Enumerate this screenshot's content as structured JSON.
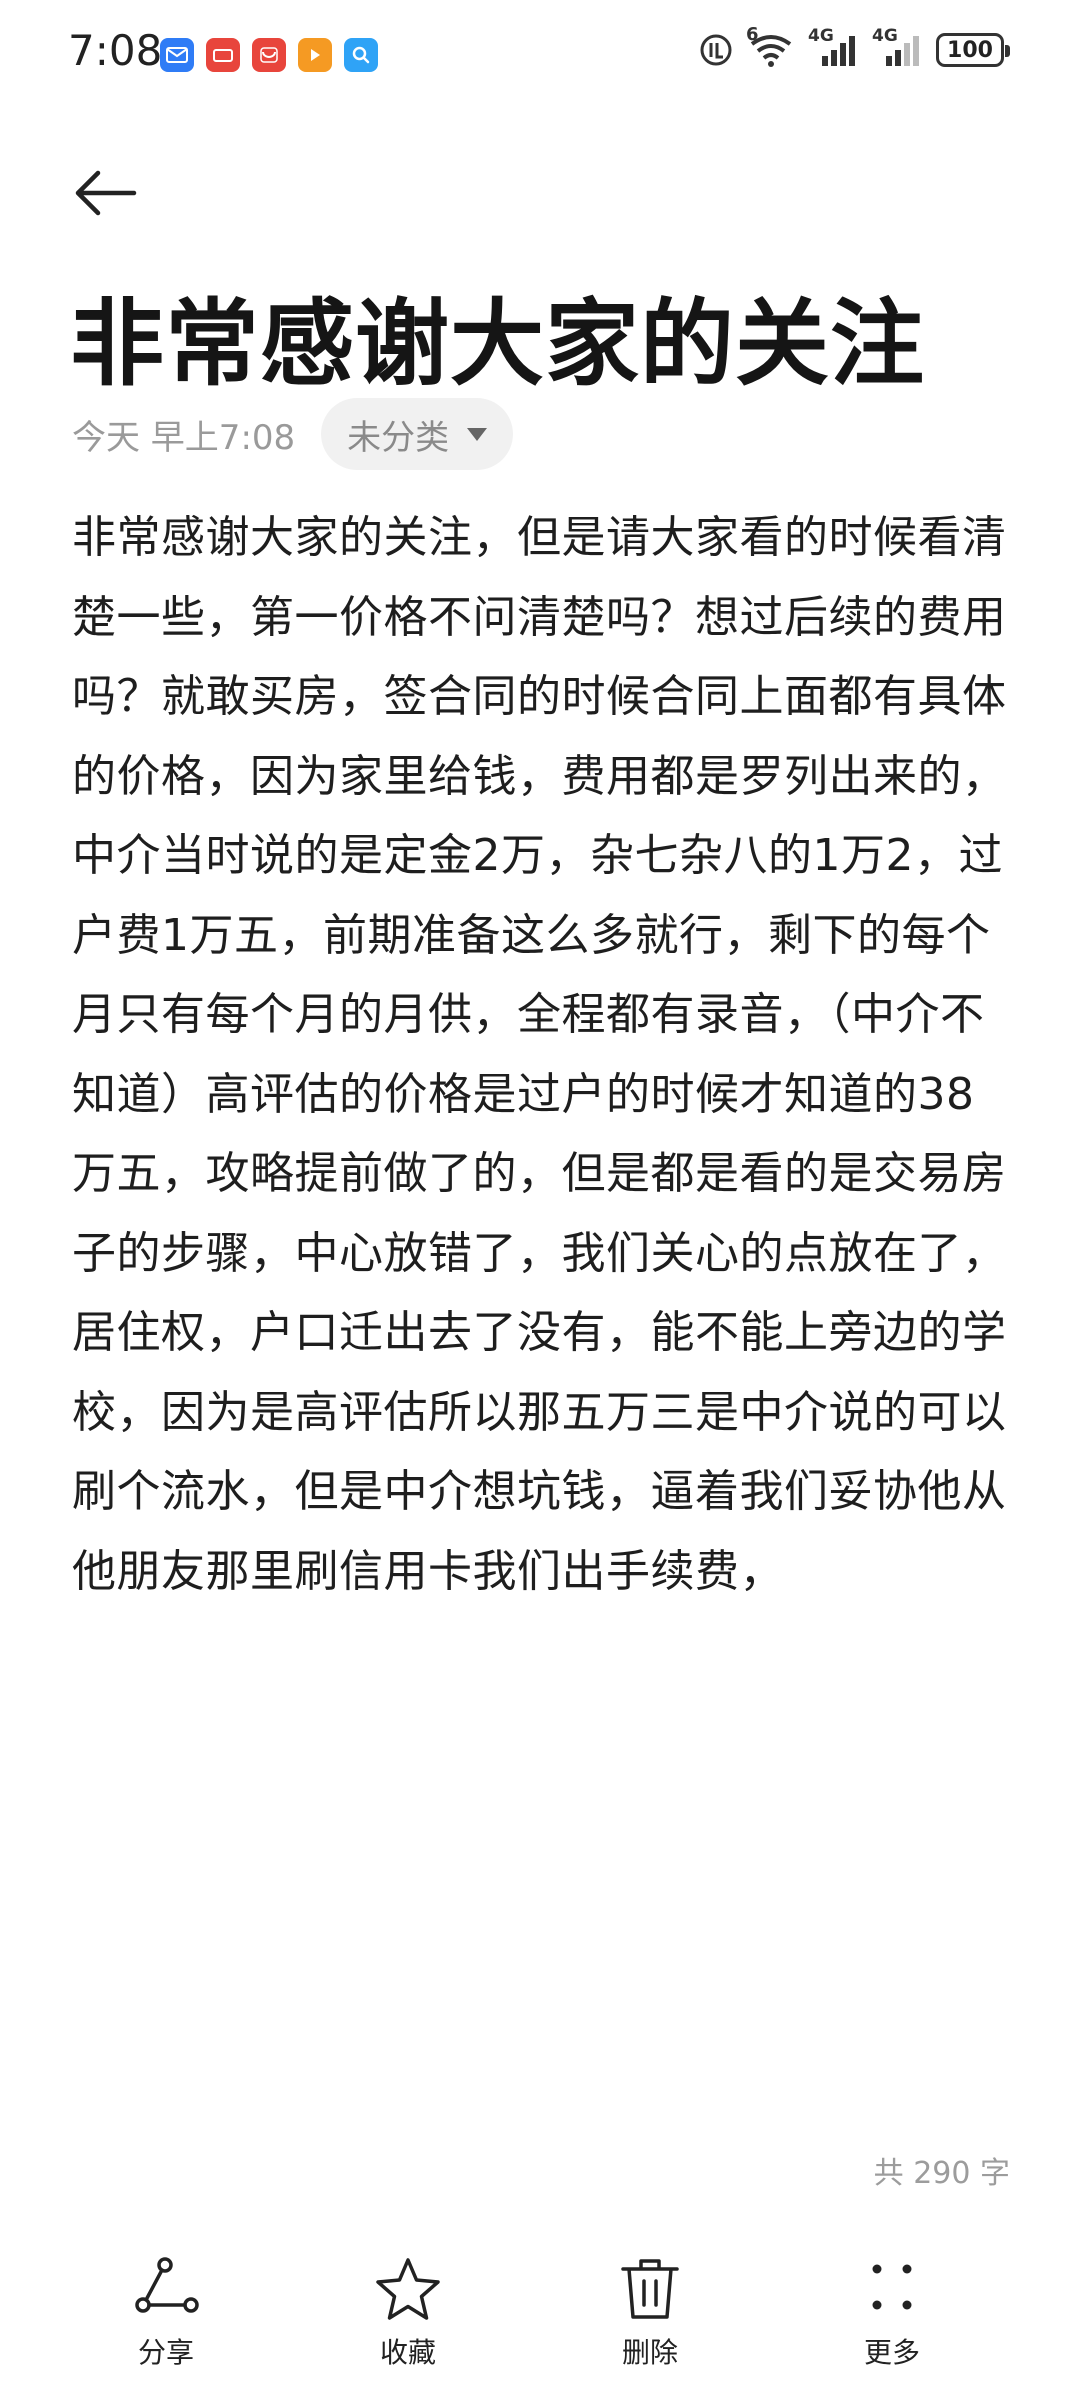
{
  "status_bar": {
    "time": "7:08",
    "network_label_1": "4G",
    "network_label_2": "4G",
    "wifi_superscript": "6",
    "battery": "100",
    "notification_icons": [
      "mail-icon",
      "shop-icon",
      "huawei-store-icon",
      "video-icon",
      "search-app-icon"
    ]
  },
  "note": {
    "title": "非常感谢大家的关注",
    "date": "今天 早上7:08",
    "category": "未分类",
    "content": "非常感谢大家的关注，但是请大家看的时候看清楚一些，第一价格不问清楚吗？想过后续的费用吗？就敢买房，签合同的时候合同上面都有具体的价格，因为家里给钱，费用都是罗列出来的，中介当时说的是定金2万，杂七杂八的1万2，过户费1万五，前期准备这么多就行，剩下的每个月只有每个月的月供，全程都有录音，（中介不知道）高评估的价格是过户的时候才知道的38万五，攻略提前做了的，但是都是看的是交易房子的步骤，中心放错了，我们关心的点放在了，居住权，户口迁出去了没有，能不能上旁边的学校，因为是高评估所以那五万三是中介说的可以刷个流水，但是中介想坑钱，逼着我们妥协他从他朋友那里刷信用卡我们出手续费，",
    "word_count": "共 290 字"
  },
  "toolbar": {
    "share": "分享",
    "favorite": "收藏",
    "delete": "删除",
    "more": "更多"
  },
  "colors": {
    "text": "#1e1e1e",
    "secondary": "#9a9a9a",
    "chip_bg": "#f1f1f1"
  }
}
